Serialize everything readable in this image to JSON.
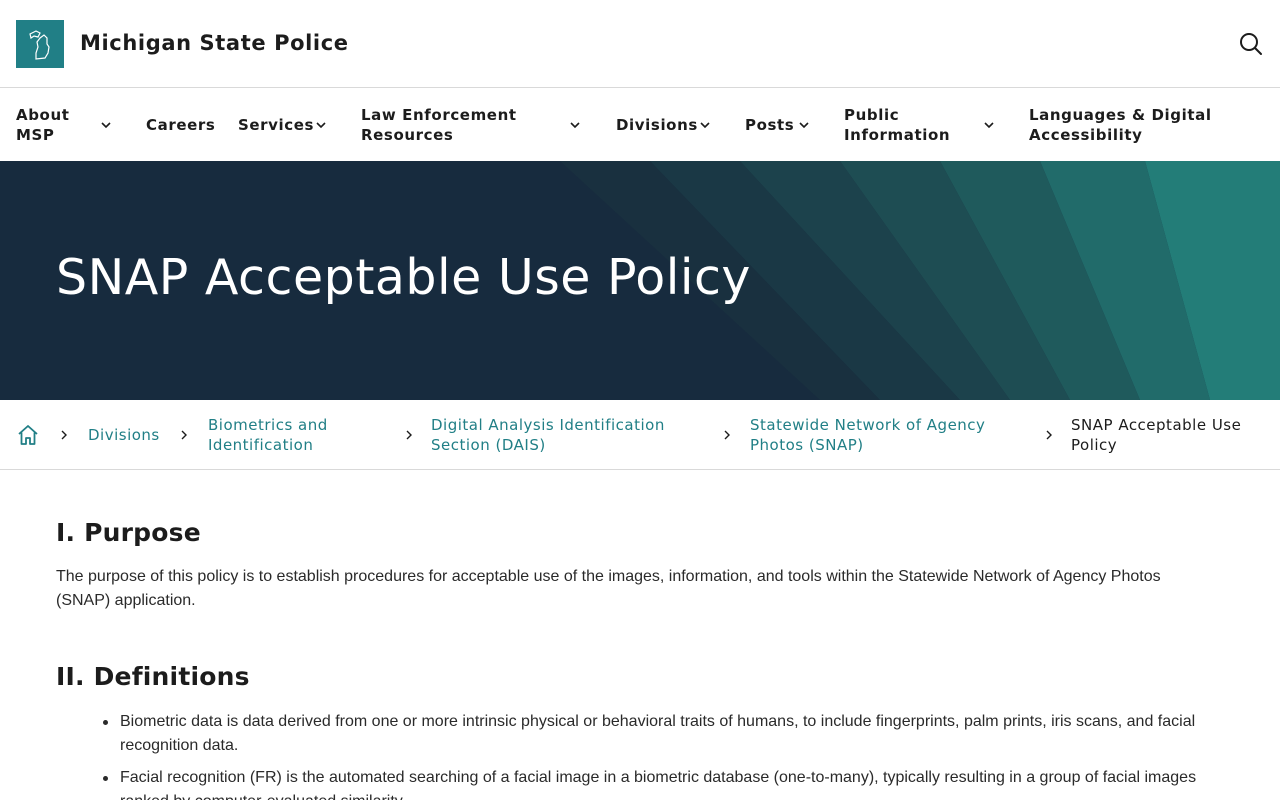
{
  "site": {
    "title": "Michigan State Police",
    "logo_icon": "michigan-map-icon",
    "brand_color": "#217f86"
  },
  "nav": {
    "items": [
      {
        "label": "About MSP",
        "has_dropdown": true
      },
      {
        "label": "Careers",
        "has_dropdown": false
      },
      {
        "label": "Services",
        "has_dropdown": true
      },
      {
        "label": "Law Enforcement Resources",
        "has_dropdown": true
      },
      {
        "label": "Divisions",
        "has_dropdown": true
      },
      {
        "label": "Posts",
        "has_dropdown": true
      },
      {
        "label": "Public Information",
        "has_dropdown": true
      },
      {
        "label": "Languages & Digital Accessibility",
        "has_dropdown": false
      }
    ]
  },
  "hero": {
    "title": "SNAP Acceptable Use Policy",
    "bg_color": "#172b3e"
  },
  "breadcrumb": {
    "home_icon": "home-icon",
    "links": [
      "Divisions",
      "Biometrics and Identification",
      "Digital Analysis Identification Section (DAIS)",
      "Statewide Network of Agency Photos (SNAP)"
    ],
    "current": "SNAP Acceptable Use Policy"
  },
  "content": {
    "purpose": {
      "heading": "I. Purpose",
      "text": "The purpose of this policy is to establish procedures for acceptable use of the images, information, and tools within the Statewide Network of Agency Photos (SNAP) application."
    },
    "definitions": {
      "heading": "II. Definitions",
      "items": [
        "Biometric data is data derived from one or more intrinsic physical or behavioral traits of humans, to include fingerprints, palm prints, iris scans, and facial recognition data.",
        "Facial recognition (FR) is the automated searching of a facial image in a biometric database (one-to-many), typically resulting in a group of facial images ranked by computer-evaluated similarity."
      ]
    }
  }
}
